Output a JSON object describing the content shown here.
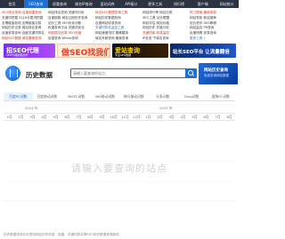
{
  "topnav": [
    "首页",
    "SEO查询",
    "权重查询",
    "域名IP查询",
    "爱站词库",
    "API接口",
    "更多工具",
    "排行榜",
    "客户端",
    "网站统计"
  ],
  "links": {
    "col1": [
      {
        "text": "SEO综合查询  百度权重查询",
        "color": "red"
      },
      {
        "text": "关键词挖掘  5118长尾词挖掘",
        "color": "default"
      },
      {
        "text": "友情链接检测  友情链接交易",
        "color": "default"
      },
      {
        "text": "网站历史记录  网站排名查询",
        "color": "default"
      },
      {
        "text": "百度收录查询  百度关键词排名",
        "color": "default"
      },
      {
        "text": "网站SEO数据  域名备案查询",
        "color": "red"
      }
    ],
    "col2": [
      {
        "text": "网站排名查询  关键词分析",
        "color": "default"
      },
      {
        "text": "百度指数  域名注册历史查询",
        "color": "default"
      },
      {
        "text": "站长工具  SEO优化诊断",
        "color": "default"
      },
      {
        "text": "权重查询平台  关键词优化",
        "color": "default"
      },
      {
        "text": "网站提交收录  SEO外链",
        "color": "red"
      },
      {
        "text": "反链查询  Whois查询",
        "color": "default"
      }
    ],
    "col3": [
      {
        "text": "综合SEO数据查询工具",
        "color": "red"
      },
      {
        "text": "网站历史数据查询",
        "color": "default"
      },
      {
        "text": "百度网站收录查询",
        "color": "default"
      },
      {
        "text": "关键词排名监控工具",
        "color": "blue"
      },
      {
        "text": "网站速度测试  蜘蛛模拟",
        "color": "default"
      },
      {
        "text": "域名年龄查询  备案查询",
        "color": "default"
      }
    ],
    "col4": [
      {
        "text": "网站排行榜  网站分类",
        "color": "default"
      },
      {
        "text": "SEO工具  站长联盟",
        "color": "default"
      },
      {
        "text": "网站评估  网站价值",
        "color": "default"
      },
      {
        "text": "网站历史  外链分析",
        "color": "default"
      },
      {
        "text": "关键词库  收录监控",
        "color": "red"
      },
      {
        "text": "IP反查  子域名查询",
        "color": "default"
      }
    ],
    "col5": [
      {
        "text": "热门搜索  最新收录",
        "color": "red"
      },
      {
        "text": "网站导航  新站推荐",
        "color": "default"
      },
      {
        "text": "站长资讯  SEO教程",
        "color": "default"
      },
      {
        "text": "网站监控  PR查询",
        "color": "default"
      },
      {
        "text": "百度快照  收录查询",
        "color": "default"
      },
      {
        "text": "更多工具 »",
        "color": "blue"
      }
    ]
  },
  "banners": [
    {
      "title": "招SEO代理",
      "sub": "SEO代理加盟合作"
    },
    {
      "title": "做SEO找我们",
      "sub": ""
    },
    {
      "title": "爱站查询",
      "sub": "专业SEO数据"
    },
    {
      "title": "站长SEO平台 让流量翻倍",
      "sub": ""
    }
  ],
  "search": {
    "brand": "历史数据",
    "placeholder": "请输入要查询的站点",
    "promo_title": "网站历史查询",
    "promo_sub": "免费查询网站数据"
  },
  "tabs": [
    "百度PC词数",
    "百度移动词数",
    "360PC词数",
    "360移动词数",
    "神马移动词数",
    "头条词数",
    "Bing词数",
    "搜狗PC词数"
  ],
  "tab_active": 0,
  "years": {
    "left": "2024 年",
    "right": "2025 年"
  },
  "months": [
    "1月",
    "2月",
    "3月",
    "4月",
    "5月",
    "6月",
    "7月",
    "8月",
    "9月",
    "10月",
    "11月",
    "12月",
    "1月",
    "2月",
    "3月",
    "4月",
    "5月",
    "6月",
    "7月",
    "8月"
  ],
  "chart_placeholder": "请输入要查询的站点",
  "footer": "历史数据查询平台提供网站历史收录、权重、关键词排名等SEO历史数据查询服务。"
}
